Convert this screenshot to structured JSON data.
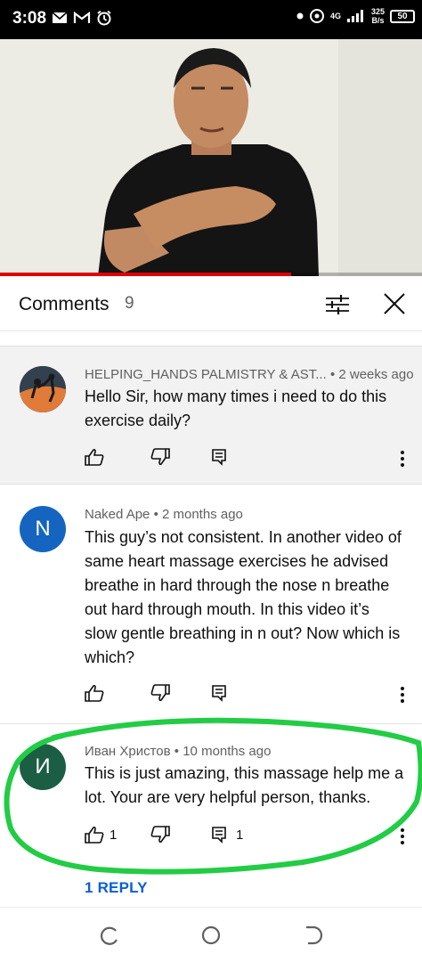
{
  "status_bar": {
    "time": "3:08",
    "speed_value": "325",
    "speed_unit": "B/s",
    "battery": "50",
    "network": "4G"
  },
  "video": {
    "progress_percent": 69
  },
  "header": {
    "title": "Comments",
    "count": "9"
  },
  "comments": [
    {
      "author": "HELPING_HANDS PALMISTRY & AST...",
      "time": "• 2 weeks ago",
      "text": "Hello Sir, how many times i need to do this exercise daily?",
      "likes": "",
      "replies": "",
      "avatar_letter": "",
      "avatar_color": "#2a3440"
    },
    {
      "author": "Naked Ape",
      "time": "• 2 months ago",
      "text": "This guy’s not consistent. In another video of same heart massage exercises he advised breathe in hard through the nose n breathe out hard through mouth. In this video it’s slow gentle breathing in n out? Now which is which?",
      "likes": "",
      "replies": "",
      "avatar_letter": "N",
      "avatar_color": "#1565c0"
    },
    {
      "author": "Иван Христов",
      "time": "• 10 months ago",
      "text": "This is just amazing, this massage help me a lot. Your are very helpful person, thanks.",
      "likes": "1",
      "replies": "1",
      "avatar_letter": "И",
      "avatar_color": "#1b5e44"
    }
  ],
  "reply_link": "1 REPLY",
  "colors": {
    "accent_blue": "#065fd4",
    "progress_red": "#e00000",
    "annotation_green": "#22cc44"
  }
}
